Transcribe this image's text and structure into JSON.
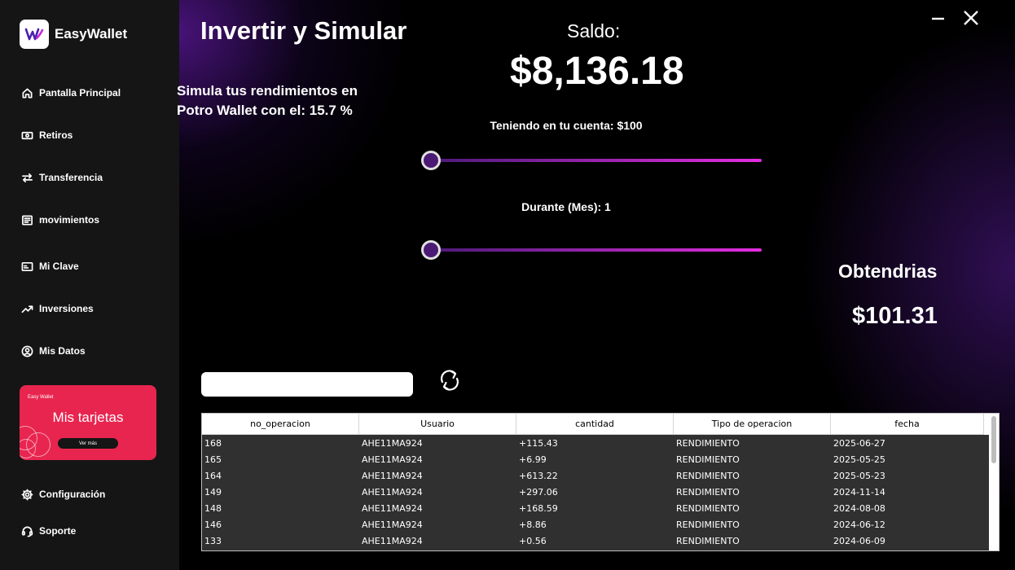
{
  "app": {
    "name": "EasyWallet"
  },
  "sidebar": {
    "items": [
      {
        "label": "Pantalla Principal",
        "icon": "home-icon"
      },
      {
        "label": "Retiros",
        "icon": "cash-icon"
      },
      {
        "label": "Transferencia",
        "icon": "transfer-icon"
      },
      {
        "label": "movimientos",
        "icon": "list-icon"
      },
      {
        "label": "Mi Clave",
        "icon": "card-key-icon"
      },
      {
        "label": "Inversiones",
        "icon": "trending-up-icon"
      },
      {
        "label": "Mis Datos",
        "icon": "user-circle-icon"
      }
    ],
    "card": {
      "brand": "Easy Wallet",
      "title": "Mis tarjetas",
      "button": "Ver más"
    },
    "bottom": [
      {
        "label": "Configuración",
        "icon": "gear-icon"
      },
      {
        "label": "Soporte",
        "icon": "headset-icon"
      }
    ]
  },
  "main": {
    "title": "Invertir y Simular",
    "sim_line1": "Simula tus rendimientos en",
    "sim_line2": "Potro Wallet con el: 15.7 %",
    "saldo_label": "Saldo:",
    "saldo_value": "$8,136.18",
    "slider_amount_label": "Teniendo en tu cuenta: $100",
    "slider_amount_value": 100,
    "slider_months_label": "Durante (Mes): 1",
    "slider_months_value": 1,
    "result_label": "Obtendrias",
    "result_value": "$101.31",
    "search": {
      "value": "",
      "placeholder": ""
    }
  },
  "table": {
    "columns": [
      "no_operacion",
      "Usuario",
      "cantidad",
      "Tipo de operacion",
      "fecha"
    ],
    "rows": [
      [
        "168",
        "AHE11MA924",
        "+115.43",
        "RENDIMIENTO",
        "2025-06-27"
      ],
      [
        "165",
        "AHE11MA924",
        "+6.99",
        "RENDIMIENTO",
        "2025-05-25"
      ],
      [
        "164",
        "AHE11MA924",
        "+613.22",
        "RENDIMIENTO",
        "2025-05-23"
      ],
      [
        "149",
        "AHE11MA924",
        "+297.06",
        "RENDIMIENTO",
        "2024-11-14"
      ],
      [
        "148",
        "AHE11MA924",
        "+168.59",
        "RENDIMIENTO",
        "2024-08-08"
      ],
      [
        "146",
        "AHE11MA924",
        "+8.86",
        "RENDIMIENTO",
        "2024-06-12"
      ],
      [
        "133",
        "AHE11MA924",
        "+0.56",
        "RENDIMIENTO",
        "2024-06-09"
      ]
    ]
  },
  "colors": {
    "accent": "#e32de0",
    "card": "#e8254f",
    "sidebar": "#151515",
    "slider_thumb": "#4b1a75"
  }
}
